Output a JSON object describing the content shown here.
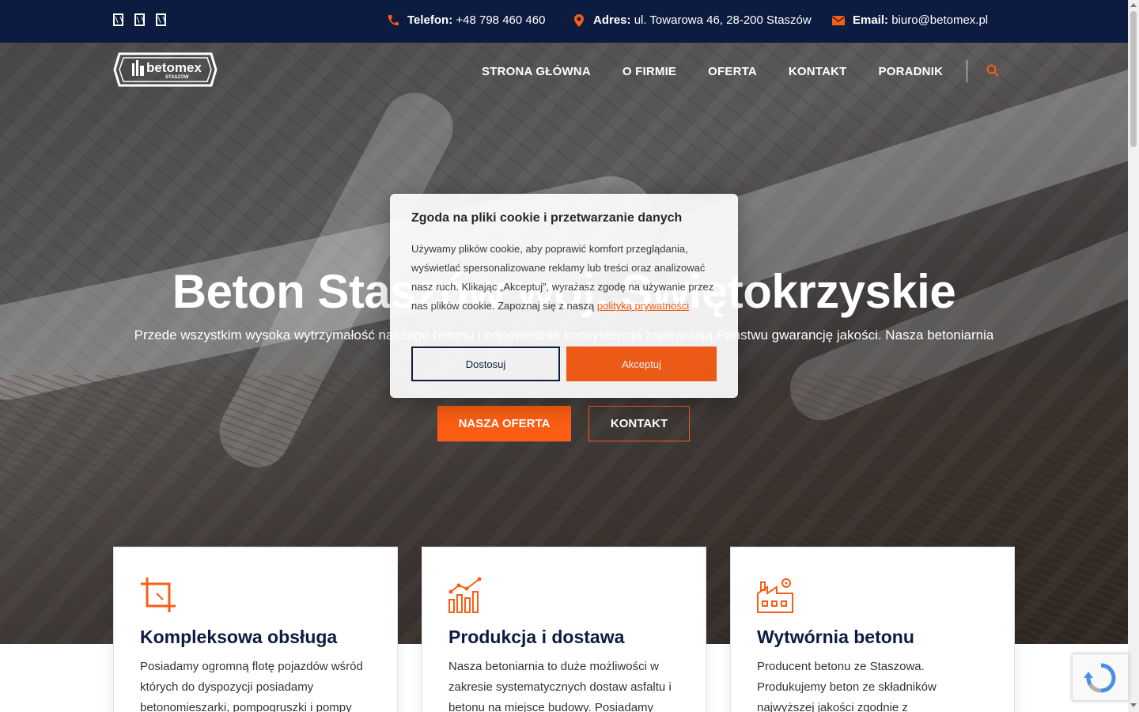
{
  "topbar": {
    "social_icons": [
      "facebook-icon",
      "instagram-icon",
      "youtube-icon"
    ],
    "phone_label": "Telefon:",
    "phone_value": "+48 798 460 460",
    "address_label": "Adres:",
    "address_value": "ul. Towarowa 46, 28-200 Staszów",
    "email_label": "Email:",
    "email_value": "biuro@betomex.pl"
  },
  "logo": {
    "brand": "betomex",
    "town": "STASZÓW"
  },
  "nav": {
    "items": [
      "STRONA GŁÓWNA",
      "O FIRMIE",
      "OFERTA",
      "KONTAKT",
      "PORADNIK"
    ]
  },
  "hero": {
    "title": "Beton Staszów woj. Świętokrzyskie",
    "subtitle": "Przede wszystkim wysoka wytrzymałość naszego betonu i odpowiednia konsystencja zapewniają Państwu gwarancję jakości. Nasza betoniarnia",
    "offer_button": "NASZA OFERTA",
    "contact_button": "KONTAKT"
  },
  "cards": [
    {
      "title": "Kompleksowa obsługa",
      "text": "Posiadamy ogromną flotę pojazdów wśród których do dyspozycji posiadamy betonomieszarki, pompogruszki i pompy"
    },
    {
      "title": "Produkcja i dostawa",
      "text": "Nasza betoniarnia to duże możliwości w zakresie systematycznych dostaw asfaltu i betonu na miejsce budowy. Posiadamy"
    },
    {
      "title": "Wytwórnia betonu",
      "text": "Producent betonu ze Staszowa. Produkujemy beton ze składników najwyższej jakości zgodnie z obowiązującymi w Europie"
    }
  ],
  "cookie": {
    "title": "Zgoda na pliki cookie i przetwarzanie danych",
    "text": "Używamy plików cookie, aby poprawić komfort przeglądania, wyświetlać spersonalizowane reklamy lub treści oraz analizować nasz ruch. Klikając „Akceptuj”, wyrażasz zgodę na używanie przez nas plików cookie. Zapoznaj się z naszą",
    "link_text": "polityką prywatności",
    "customize_button": "Dostosuj",
    "accept_button": "Akceptuj"
  },
  "colors": {
    "navy": "#0c1c40",
    "accent": "#fa5d13"
  }
}
